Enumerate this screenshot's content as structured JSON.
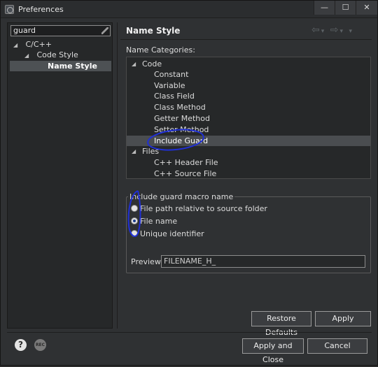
{
  "window": {
    "title": "Preferences",
    "controls": {
      "minimize": "—",
      "maximize": "☐",
      "close": "✕"
    }
  },
  "sidebar": {
    "filter_value": "guard",
    "tree": [
      {
        "label": "C/C++",
        "expanded": true
      },
      {
        "label": "Code Style",
        "expanded": true
      },
      {
        "label": "Name Style",
        "selected": true
      }
    ]
  },
  "page": {
    "title": "Name Style",
    "nav": {
      "back": "⇦",
      "back_menu": "▾",
      "forward": "⇨",
      "forward_menu": "▾",
      "more": "▾"
    },
    "categories_label": "Name Categories:",
    "categories": [
      {
        "label": "Code",
        "group": true,
        "expanded": true
      },
      {
        "label": "Constant"
      },
      {
        "label": "Variable"
      },
      {
        "label": "Class Field"
      },
      {
        "label": "Class Method"
      },
      {
        "label": "Getter Method"
      },
      {
        "label": "Setter Method"
      },
      {
        "label": "Include Guard",
        "selected": true
      },
      {
        "label": "Files",
        "group": true,
        "expanded": true
      },
      {
        "label": "C++ Header File"
      },
      {
        "label": "C++ Source File"
      }
    ],
    "guard_group": {
      "title": "Include guard macro name",
      "options": [
        {
          "label": "File path relative to source folder",
          "checked": false
        },
        {
          "label": "File name",
          "checked": true
        },
        {
          "label": "Unique identifier",
          "checked": false
        }
      ],
      "preview_label": "Preview:",
      "preview_value": "FILENAME_H_"
    },
    "restore_defaults": "Restore Defaults",
    "apply": "Apply"
  },
  "footer": {
    "help_icon": "?",
    "rec_icon": "REC",
    "apply_and_close": "Apply and Close",
    "cancel": "Cancel"
  },
  "colors": {
    "background": "#2f3133",
    "panel": "#262829",
    "selection": "#4a4d50",
    "annotation": "#1f2fd6"
  },
  "icons": [
    "app-icon",
    "help-icon",
    "rec-icon",
    "expand-arrow-icon",
    "back-arrow-icon",
    "forward-arrow-icon",
    "clear-filter-icon"
  ]
}
